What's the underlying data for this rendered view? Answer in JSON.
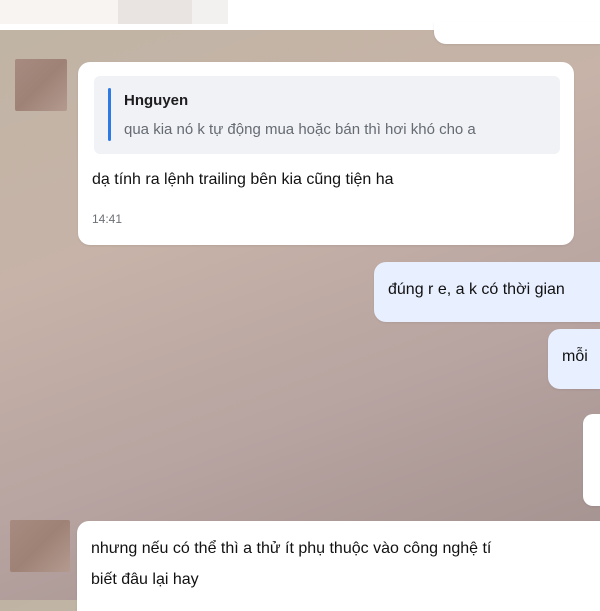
{
  "conversation": {
    "messages": [
      {
        "direction": "incoming",
        "reply_to": {
          "author": "Hnguyen",
          "text": "qua kia nó k tự động mua hoặc bán thì hơi khó cho a"
        },
        "text": "dạ tính ra lệnh trailing bên kia cũng tiện ha",
        "time": "14:41"
      },
      {
        "direction": "outgoing",
        "text": "đúng r e, a k có thời gian"
      },
      {
        "direction": "outgoing",
        "text": "mỗi"
      },
      {
        "direction": "incoming",
        "text_line1": "nhưng nếu có thể thì a thử ít phụ thuộc vào công nghệ tí",
        "text_line2": "biết đâu lại hay"
      }
    ]
  },
  "colors": {
    "incoming_bubble": "#ffffff",
    "outgoing_bubble": "#e8efff",
    "quote_background": "#f1f2f5",
    "quote_accent": "#2e7ae5"
  }
}
